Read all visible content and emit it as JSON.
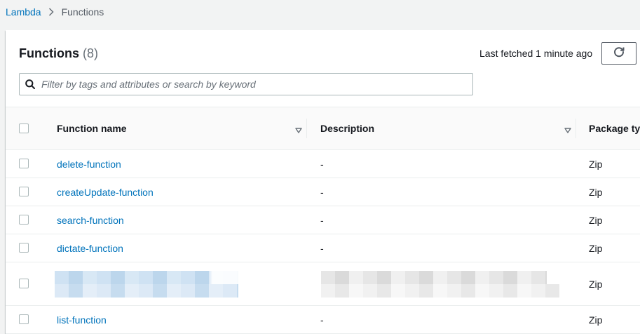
{
  "breadcrumb": {
    "root": "Lambda",
    "current": "Functions"
  },
  "panel": {
    "title": "Functions",
    "count": "(8)",
    "last_fetched": "Last fetched 1 minute ago",
    "filter_placeholder": "Filter by tags and attributes or search by keyword"
  },
  "table": {
    "columns": {
      "name": "Function name",
      "description": "Description",
      "package": "Package type"
    },
    "rows": [
      {
        "name": "delete-function",
        "description": "-",
        "package": "Zip"
      },
      {
        "name": "createUpdate-function",
        "description": "-",
        "package": "Zip"
      },
      {
        "name": "search-function",
        "description": "-",
        "package": "Zip"
      },
      {
        "name": "dictate-function",
        "description": "-",
        "package": "Zip"
      },
      {
        "name": "",
        "description": "",
        "package": "Zip",
        "redacted": true
      },
      {
        "name": "list-function",
        "description": "-",
        "package": "Zip"
      }
    ]
  },
  "colors": {
    "link": "#0073bb",
    "background": "#f2f3f3",
    "border": "#eaeded"
  },
  "icons": {
    "breadcrumb_separator": "chevron-right-icon",
    "refresh": "refresh-icon",
    "search": "search-icon",
    "sort": "sort-down-icon"
  }
}
